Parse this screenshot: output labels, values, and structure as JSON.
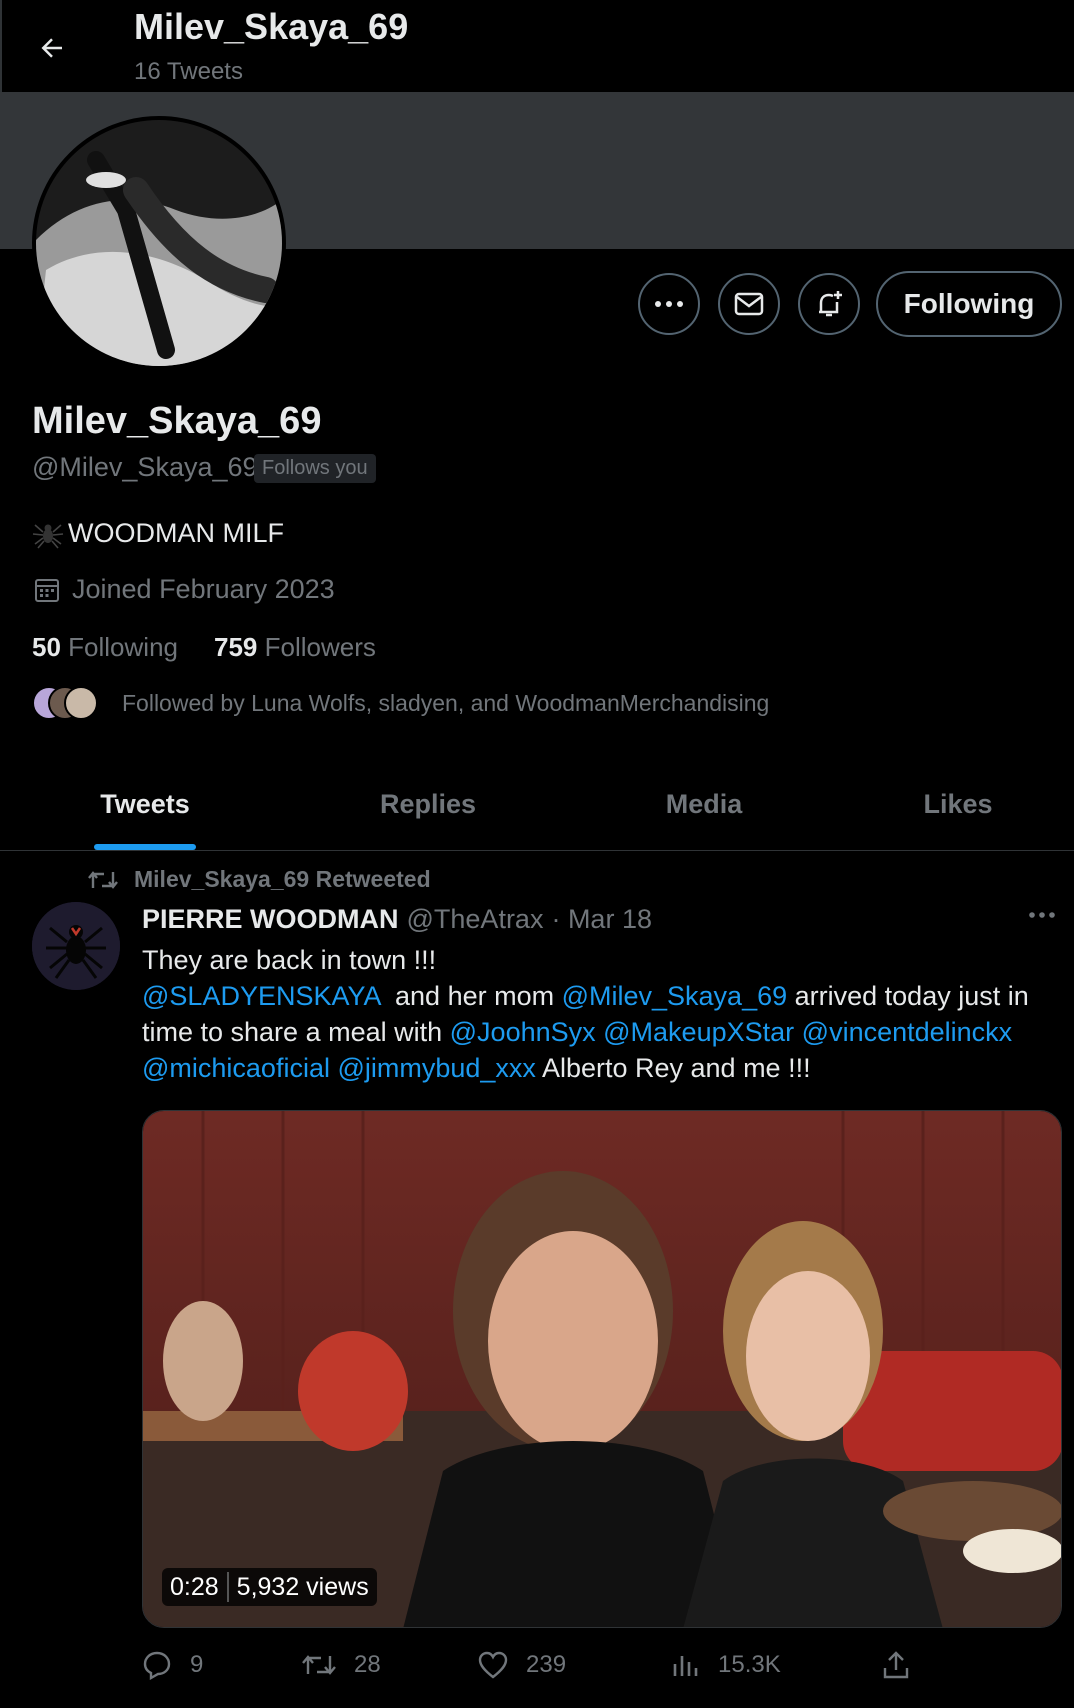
{
  "header": {
    "title": "Milev_Skaya_69",
    "subtitle": "16 Tweets"
  },
  "profile": {
    "display_name": "Milev_Skaya_69",
    "handle": "@Milev_Skaya_69",
    "follows_you": "Follows you",
    "bio": "WOODMAN MILF",
    "joined": "Joined February 2023",
    "following_count": "50",
    "following_label": "Following",
    "followers_count": "759",
    "followers_label": "Followers",
    "followed_by": "Followed by Luna Wolfs, sladyen, and WoodmanMerchandising",
    "follow_button": "Following"
  },
  "tabs": [
    {
      "label": "Tweets",
      "active": true
    },
    {
      "label": "Replies",
      "active": false
    },
    {
      "label": "Media",
      "active": false
    },
    {
      "label": "Likes",
      "active": false
    }
  ],
  "tweet": {
    "retweet_label": "Milev_Skaya_69 Retweeted",
    "author_name": "PIERRE WOODMAN",
    "author_handle": "@TheAtrax",
    "date": "· Mar 18",
    "line1": "They are back in town !!!",
    "mention1": "@SLADYENSKAYA",
    "text2": "  and her mom ",
    "mention2": "@Milev_Skaya_69",
    "text3": " arrived today just in time to share a meal with ",
    "mention3": "@JoohnSyx",
    "mention4": "@MakeupXStar",
    "mention5": "@vincentdelinckx",
    "mention6": "@michicaoficial",
    "mention7": "@jimmybud_xxx",
    "text4": " Alberto Rey and me !!!",
    "video_duration": "0:28",
    "video_views": "5,932 views",
    "replies": "9",
    "retweets": "28",
    "likes": "239",
    "views": "15.3K"
  },
  "colors": {
    "background": "#000000",
    "banner": "#333639",
    "accent": "#1d9bf0",
    "muted": "#71767b",
    "text": "#e7e9ea"
  },
  "icons": [
    "back-arrow-icon",
    "more-icon",
    "mail-icon",
    "notification-add-icon",
    "spider-icon",
    "calendar-icon",
    "retweet-icon",
    "reply-icon",
    "like-icon",
    "views-icon",
    "share-icon"
  ]
}
